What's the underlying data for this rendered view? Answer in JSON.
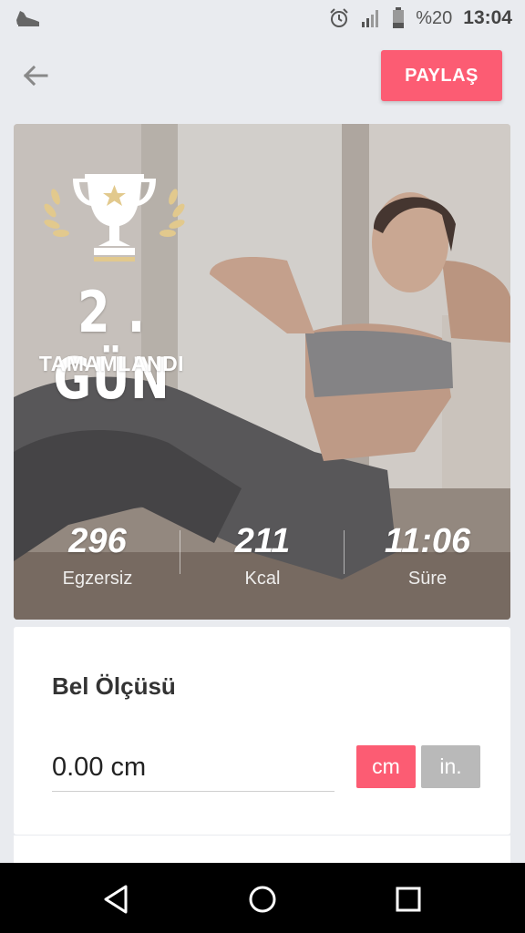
{
  "status_bar": {
    "app_icon": "sneaker-icon",
    "battery_text": "%20",
    "time": "13:04"
  },
  "header": {
    "back_icon": "arrow-back-icon",
    "share_label": "PAYLAŞ"
  },
  "hero": {
    "day_title": "2 . GÜN",
    "day_subtitle": "TAMAMLANDI",
    "stats": [
      {
        "value": "296",
        "label": "Egzersiz"
      },
      {
        "value": "211",
        "label": "Kcal"
      },
      {
        "value": "11:06",
        "label": "Süre"
      }
    ]
  },
  "measurement": {
    "title": "Bel Ölçüsü",
    "value": "0.00 cm",
    "unit_cm": "cm",
    "unit_in": "in.",
    "selected_unit": "cm"
  },
  "colors": {
    "accent": "#fc5c73",
    "unit_inactive": "#b9b9b9",
    "background": "#e9ebef"
  }
}
